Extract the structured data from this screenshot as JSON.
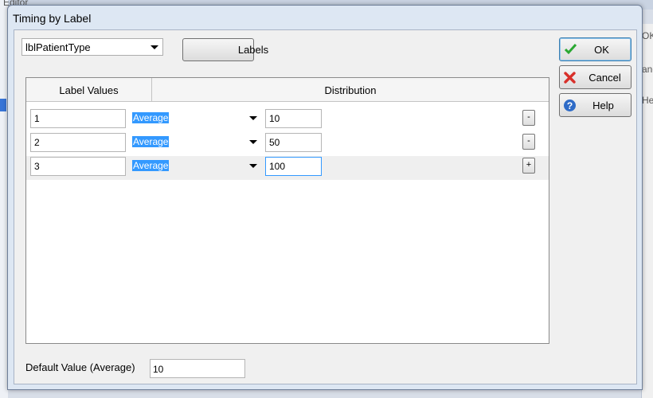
{
  "dialog": {
    "title": "Timing by Label",
    "label_combo_value": "lblPatientType",
    "labels_button": "Labels",
    "ok_button": "OK",
    "cancel_button": "Cancel",
    "help_button": "Help",
    "grid": {
      "columns": [
        "Label Values",
        "Distribution"
      ],
      "rows": [
        {
          "label": "1",
          "dist": "Average",
          "value": "10",
          "action": "-"
        },
        {
          "label": "2",
          "dist": "Average",
          "value": "50",
          "action": "-"
        },
        {
          "label": "3",
          "dist": "Average",
          "value": "100",
          "action": "+"
        }
      ]
    },
    "default_label": "Default Value (Average)",
    "default_value": "10"
  },
  "background": {
    "frag_top": "Editor",
    "frag_ok": "OK",
    "frag_cancel": "anc",
    "frag_help": "Hel"
  },
  "colors": {
    "accent_select": "#3399ff",
    "ok_check": "#2aa832",
    "cancel_x": "#d8302a",
    "help_circle": "#2e6bc7"
  }
}
